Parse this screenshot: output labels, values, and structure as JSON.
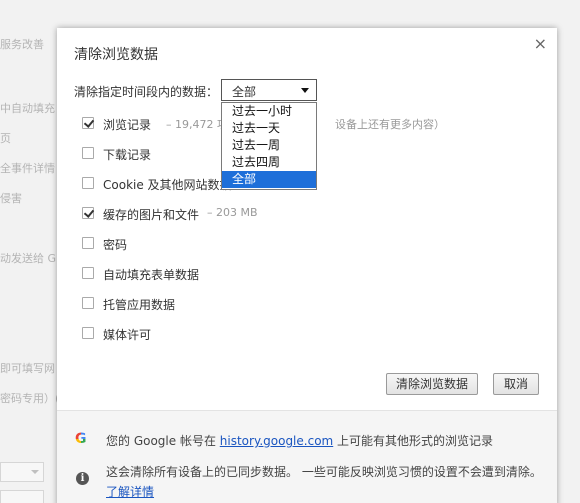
{
  "background": {
    "fragments": [
      "服务改善",
      "中自动填充",
      "页",
      "全事件详情",
      "侵害",
      "动发送给 G",
      "即可填写网",
      "密码专用）("
    ]
  },
  "dialog": {
    "title": "清除浏览数据",
    "close_glyph": "×",
    "range_label": "清除指定时间段内的数据：",
    "range_selected": "全部",
    "range_options": [
      "过去一小时",
      "过去一天",
      "过去一周",
      "过去四周",
      "全部"
    ],
    "options": [
      {
        "label": "浏览记录",
        "detail": "– 19,472 项",
        "detail_tail": "设备上还有更多内容）",
        "checked": true
      },
      {
        "label": "下载记录",
        "checked": false
      },
      {
        "label": "Cookie 及其他网站数据",
        "checked": false
      },
      {
        "label": "缓存的图片和文件",
        "detail": "– 203 MB",
        "checked": true
      },
      {
        "label": "密码",
        "checked": false
      },
      {
        "label": "自动填充表单数据",
        "checked": false
      },
      {
        "label": "托管应用数据",
        "checked": false
      },
      {
        "label": "媒体许可",
        "checked": false
      }
    ],
    "clear_button": "清除浏览数据",
    "cancel_button": "取消",
    "footer": {
      "google_icon": "G",
      "account_text_pre": "您的 Google 帐号在 ",
      "account_link": "history.google.com",
      "account_text_post": " 上可能有其他形式的浏览记录",
      "info_icon": "i",
      "sync_text": "这会清除所有设备上的已同步数据。 一些可能反映浏览习惯的设置不会遭到清除。",
      "learn_more": "了解详情"
    }
  },
  "colors": {
    "accent": "#1e6fd9",
    "link": "#1a55c0"
  }
}
